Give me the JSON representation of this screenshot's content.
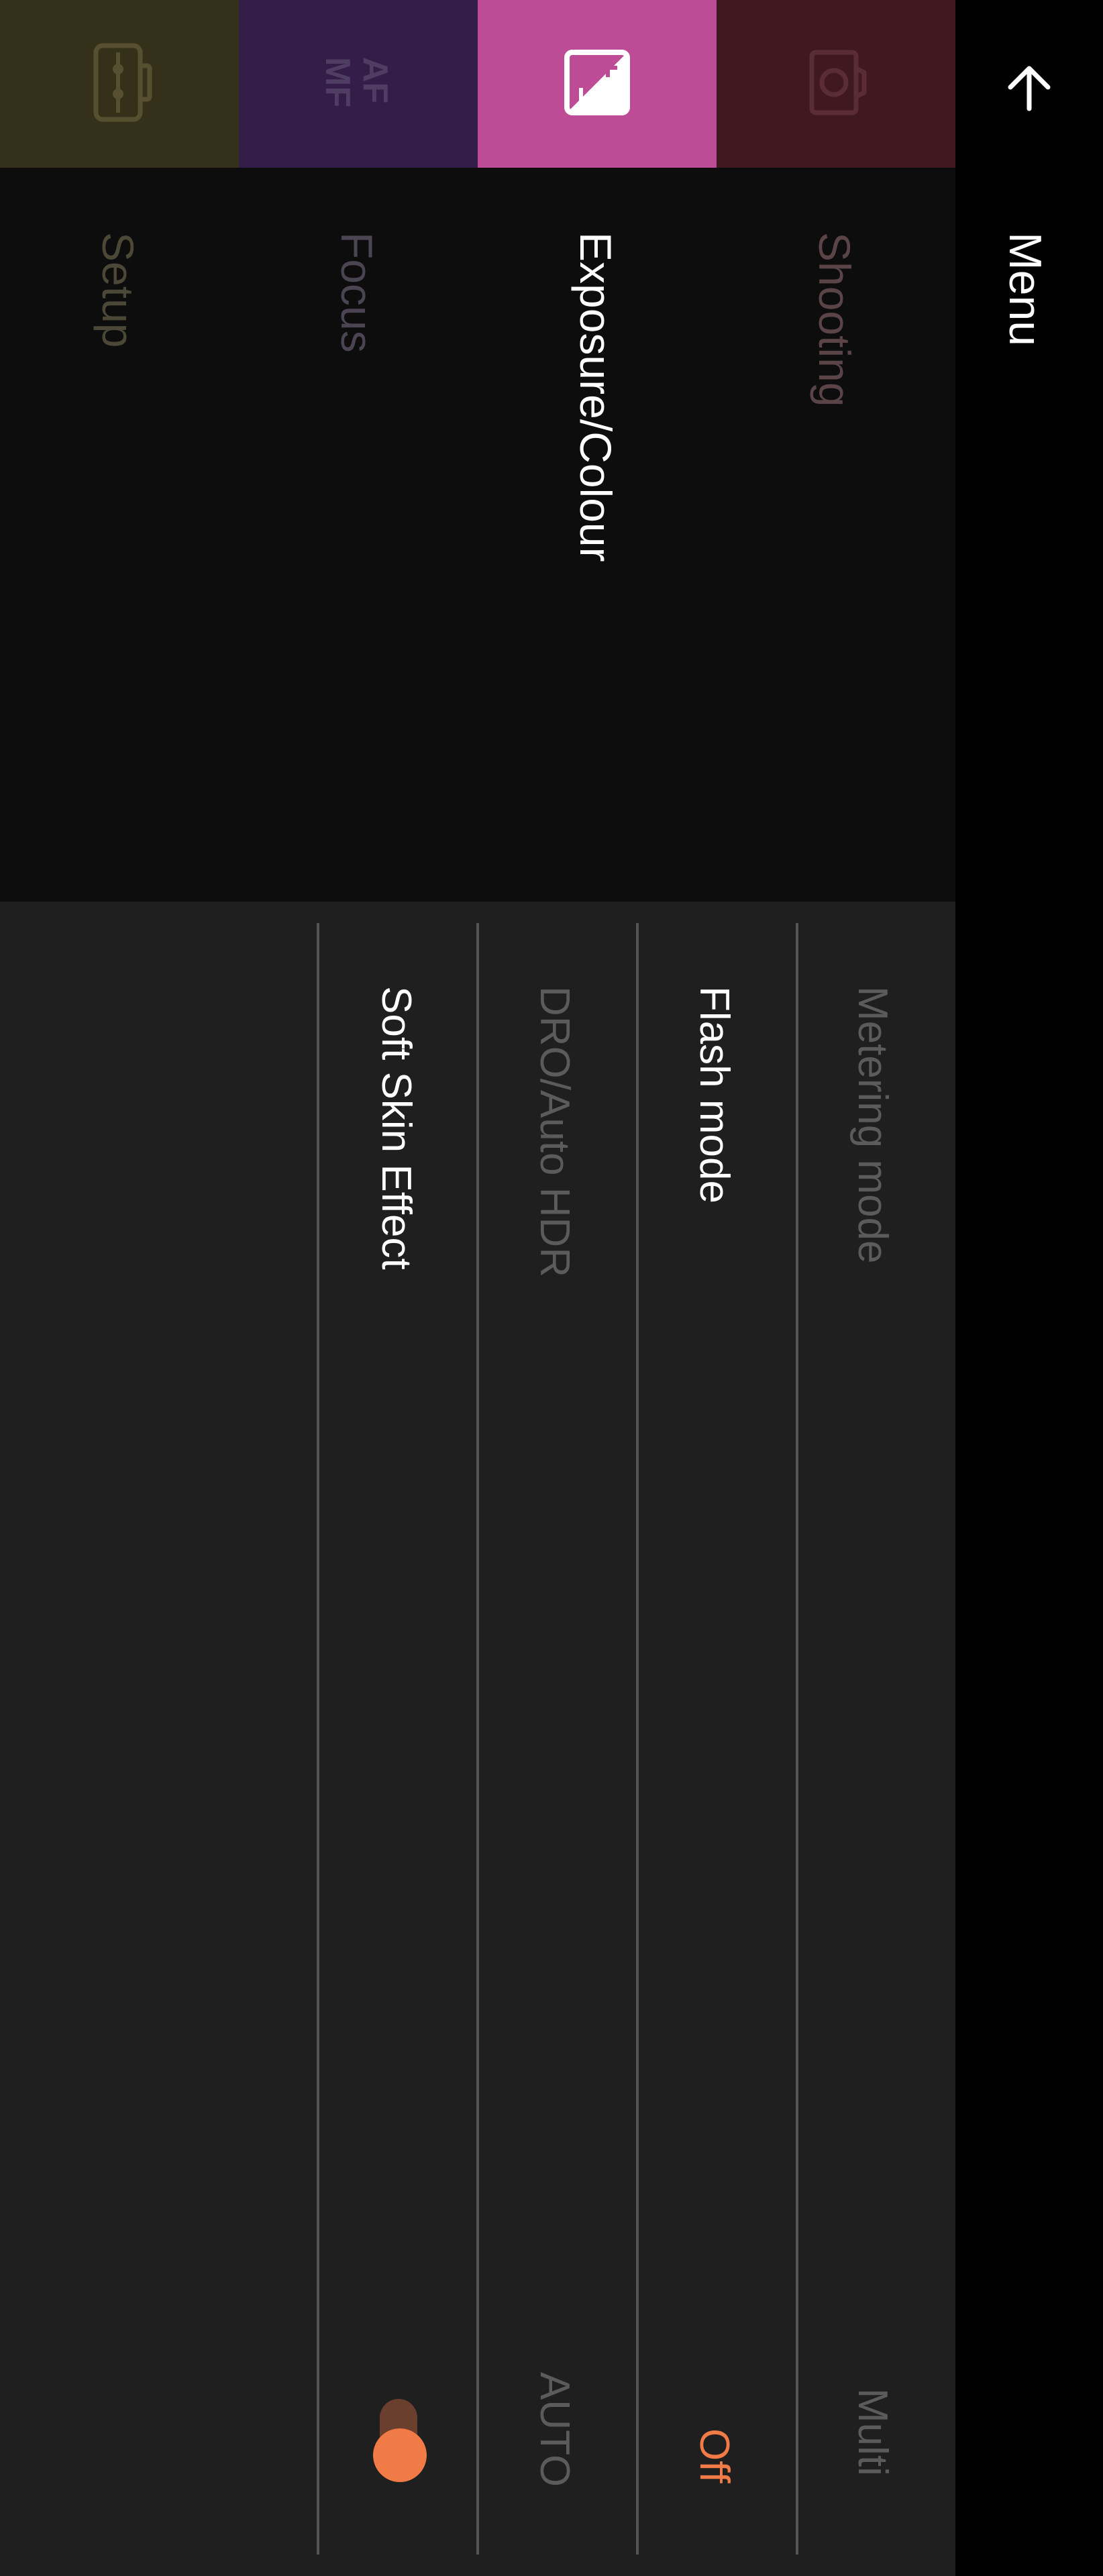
{
  "header": {
    "title": "Menu",
    "back_icon": "arrow-up-icon"
  },
  "categories": [
    {
      "label": "Shooting",
      "icon": "camera-icon",
      "color": "#3f1820",
      "text_color": "#5a4448"
    },
    {
      "label": "Exposure/Colour",
      "icon": "exposure-compensation-icon",
      "color": "#be4b96",
      "text_color": "#ffffff",
      "selected": true
    },
    {
      "label": "Focus",
      "icon": "af-mf-icon",
      "icon_text_top": "AF",
      "icon_text_bottom": "MF",
      "color": "#351d49",
      "text_color": "#4b4452"
    },
    {
      "label": "Setup",
      "icon": "toolbox-icon",
      "color": "#35301a",
      "text_color": "#4c4838"
    }
  ],
  "settings": [
    {
      "label": "Metering mode",
      "value": "Multi",
      "enabled": false
    },
    {
      "label": "Flash mode",
      "value": "Off",
      "enabled": true,
      "value_color": "#f07b47"
    },
    {
      "label": "DRO/Auto HDR",
      "value": "AUTO",
      "enabled": false
    },
    {
      "label": "Soft Skin Effect",
      "value_type": "toggle",
      "toggle_on": true,
      "enabled": true
    }
  ],
  "colors": {
    "accent": "#f07b47",
    "list_bg": "#1f1f1f",
    "category_bg": "#0d0d0d",
    "header_bg": "#000000"
  }
}
